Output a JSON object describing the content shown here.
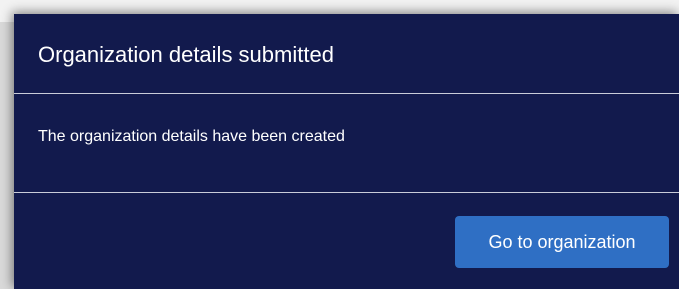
{
  "dialog": {
    "title": "Organization details submitted",
    "message": "The organization details have been created",
    "primary_button_label": "Go to organization"
  },
  "colors": {
    "dialog_background": "#121a4d",
    "button_background": "#2f6fc4",
    "text": "#ffffff",
    "divider": "#c9ccd9"
  }
}
